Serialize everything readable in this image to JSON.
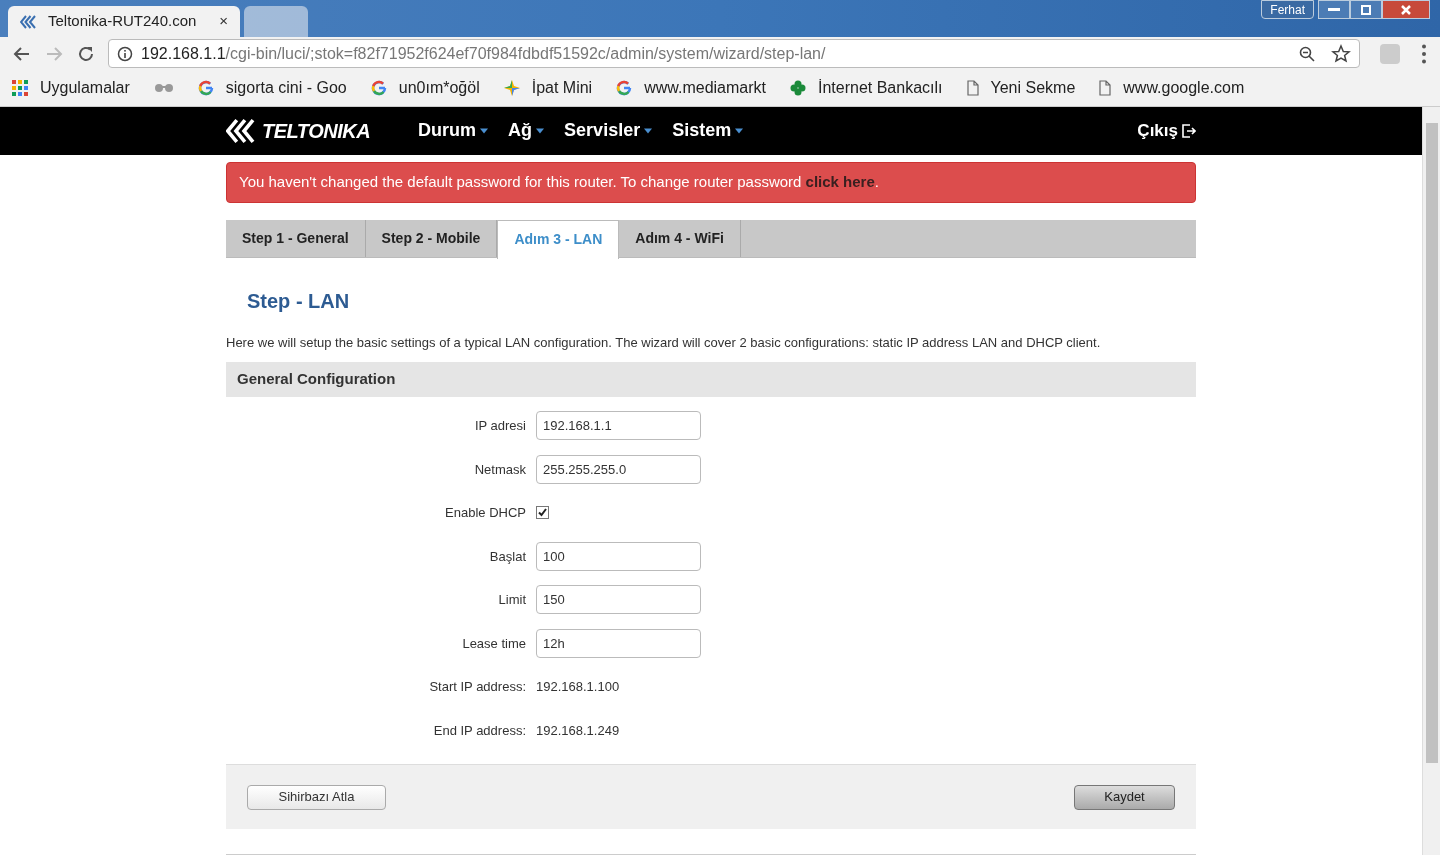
{
  "browser": {
    "tabs": [
      {
        "title": "Teltonika-RUT240.con",
        "selected": true,
        "close": "×"
      },
      {
        "selected": false
      }
    ],
    "profile": "Ferhat",
    "url": {
      "host": "192.168.1.1",
      "path": "/cgi-bin/luci/;stok=f82f71952f624ef70f984fdbdf51592c/admin/system/wizard/step-lan/"
    },
    "bookmarks": [
      {
        "kind": "apps",
        "label": "Uygulamalar"
      },
      {
        "kind": "glasses"
      },
      {
        "kind": "google",
        "label": "sigorta cini - Goo"
      },
      {
        "kind": "google",
        "label": "un0ım*oğöl"
      },
      {
        "kind": "star",
        "label": "İpat Mini"
      },
      {
        "kind": "google",
        "label": "www.mediamarkt"
      },
      {
        "kind": "clover",
        "label": "İnternet Bankacılı"
      },
      {
        "kind": "page",
        "label": "Yeni Sekme"
      },
      {
        "kind": "page",
        "label": "www.google.com"
      }
    ]
  },
  "nav": {
    "logo": "TELTONIKA",
    "menu": [
      "Durum",
      "Ağ",
      "Servisler",
      "Sistem"
    ],
    "logout": "Çıkış"
  },
  "alert": {
    "text": "You haven't changed the default password for this router. To change router password ",
    "link": "click here",
    "end": "."
  },
  "steps": [
    {
      "label": "Step 1 - General",
      "selected": false
    },
    {
      "label": "Step 2 - Mobile",
      "selected": false
    },
    {
      "label": "Adım 3 - LAN",
      "selected": true
    },
    {
      "label": "Adım 4 - WiFi",
      "selected": false
    }
  ],
  "heading": "Step - LAN",
  "description": "Here we will setup the basic settings of a typical LAN configuration. The wizard will cover 2 basic configurations: static IP address LAN and DHCP client.",
  "section": "General Configuration",
  "fields": [
    {
      "kind": "input",
      "label": "IP adresi",
      "value": "192.168.1.1"
    },
    {
      "kind": "input",
      "label": "Netmask",
      "value": "255.255.255.0"
    },
    {
      "kind": "checkbox",
      "label": "Enable DHCP",
      "checked": true
    },
    {
      "kind": "input",
      "label": "Başlat",
      "value": "100"
    },
    {
      "kind": "input",
      "label": "Limit",
      "value": "150"
    },
    {
      "kind": "input",
      "label": "Lease time",
      "value": "12h"
    },
    {
      "kind": "text",
      "label": "Start IP address:",
      "value": "192.168.1.100"
    },
    {
      "kind": "text",
      "label": "End IP address:",
      "value": "192.168.1.249"
    }
  ],
  "buttons": {
    "skip": "Sihirbazı Atla",
    "save": "Kaydet"
  }
}
